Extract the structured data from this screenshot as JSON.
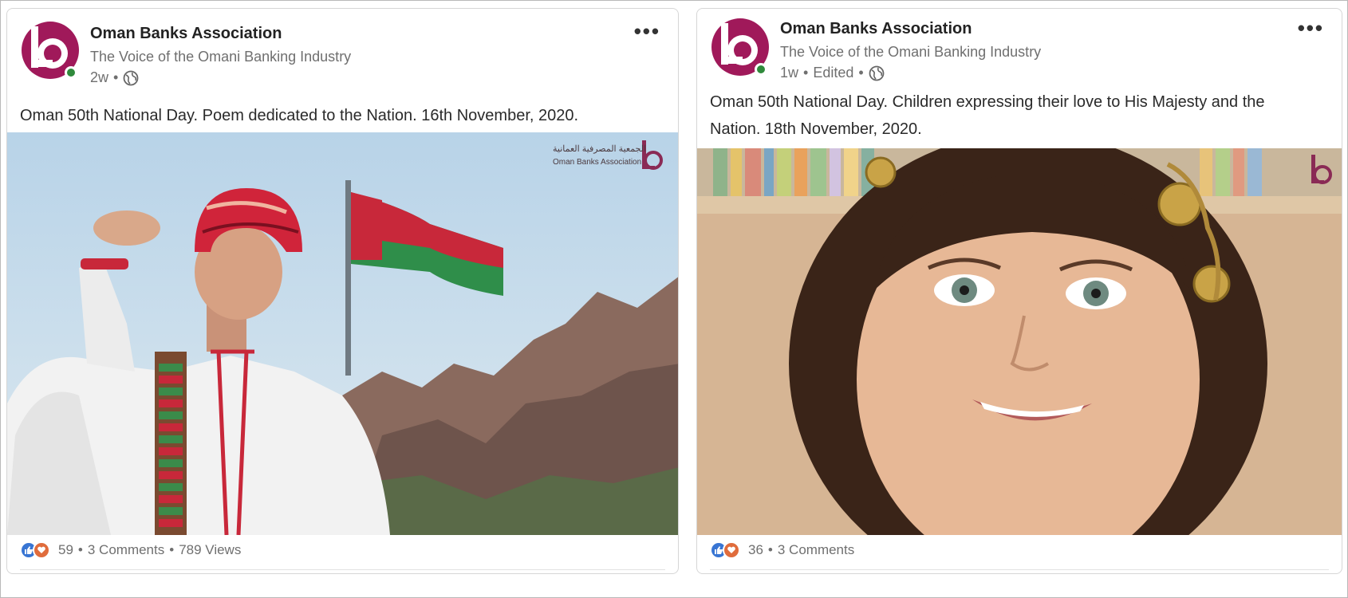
{
  "posts": [
    {
      "author": "Oman Banks Association",
      "tagline": "The Voice of the Omani Banking Industry",
      "age": "2w",
      "edited": "",
      "caption": "Oman 50th National Day. Poem dedicated to the Nation. 16th November, 2020.",
      "media_desc": "",
      "watermark_ar": "الجمعية المصرفية العمانية",
      "watermark_en": "Oman Banks Association",
      "reactions_count": "59",
      "comments": "3 Comments",
      "views": "789 Views"
    },
    {
      "author": "Oman Banks Association",
      "tagline": "The Voice of the Omani Banking Industry",
      "age": "1w",
      "edited": "Edited",
      "caption": "Oman 50th National Day. Children expressing their love to His Majesty and the Nation. 18th November, 2020.",
      "reactions_count": "36",
      "comments": "3 Comments"
    }
  ],
  "separators": {
    "dot": "•"
  },
  "icons": {
    "avatar": "oman-banks-association-logo",
    "visibility": "globe-icon",
    "menu": "more-options-icon",
    "like": "like-reaction-icon",
    "love": "love-reaction-icon"
  },
  "colors": {
    "brand": "#a0195a",
    "online": "#2f8a3b",
    "like": "#3875d3",
    "love": "#e06c3c"
  }
}
